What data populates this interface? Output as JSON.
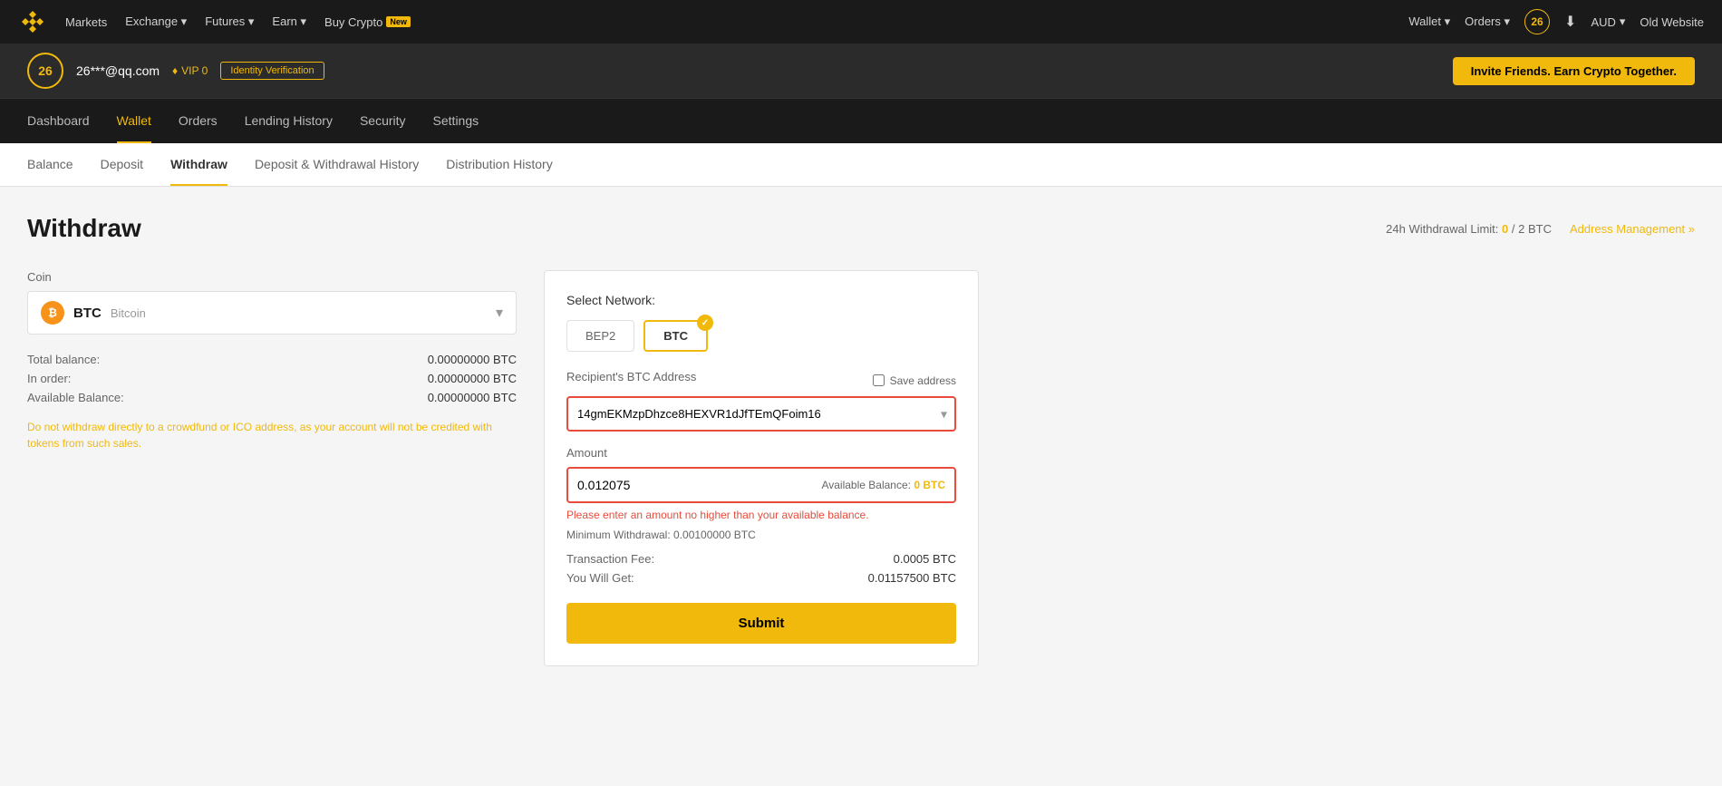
{
  "topNav": {
    "logo_text": "BINANCE",
    "grid_icon": "⊞",
    "nav_items": [
      {
        "label": "Markets",
        "has_dropdown": false
      },
      {
        "label": "Exchange",
        "has_dropdown": true
      },
      {
        "label": "Futures",
        "has_dropdown": true
      },
      {
        "label": "Earn",
        "has_dropdown": true
      },
      {
        "label": "Buy Crypto",
        "has_dropdown": false,
        "badge": "New"
      }
    ],
    "right_items": [
      {
        "label": "Wallet",
        "has_dropdown": true
      },
      {
        "label": "Orders",
        "has_dropdown": true
      }
    ],
    "user_number": "26",
    "currency": "AUD",
    "old_website": "Old Website"
  },
  "userBar": {
    "user_number": "26",
    "email": "26***@qq.com",
    "vip_text": "VIP 0",
    "identity_btn": "Identity Verification",
    "invite_btn": "Invite Friends. Earn Crypto Together."
  },
  "accountNav": {
    "items": [
      {
        "label": "Dashboard",
        "active": false
      },
      {
        "label": "Wallet",
        "active": true
      },
      {
        "label": "Orders",
        "active": false
      },
      {
        "label": "Lending History",
        "active": false
      },
      {
        "label": "Security",
        "active": false
      },
      {
        "label": "Settings",
        "active": false
      }
    ]
  },
  "subNav": {
    "items": [
      {
        "label": "Balance",
        "active": false
      },
      {
        "label": "Deposit",
        "active": false
      },
      {
        "label": "Withdraw",
        "active": true
      },
      {
        "label": "Deposit & Withdrawal History",
        "active": false
      },
      {
        "label": "Distribution History",
        "active": false
      }
    ]
  },
  "page": {
    "title": "Withdraw",
    "withdrawal_limit_label": "24h Withdrawal Limit:",
    "withdrawal_current": "0",
    "withdrawal_separator": "/",
    "withdrawal_max": "2 BTC",
    "address_management": "Address Management »"
  },
  "coinSelector": {
    "symbol": "BTC",
    "full_name": "Bitcoin"
  },
  "balances": {
    "total_label": "Total balance:",
    "total_value": "0.00000000 BTC",
    "order_label": "In order:",
    "order_value": "0.00000000 BTC",
    "available_label": "Available Balance:",
    "available_value": "0.00000000 BTC"
  },
  "warning": {
    "text": "Do not withdraw directly to a crowdfund or ICO address, as your account will not be credited with tokens from such sales."
  },
  "networkSection": {
    "title": "Select Network:",
    "options": [
      {
        "label": "BEP2",
        "active": false
      },
      {
        "label": "BTC",
        "active": true
      }
    ]
  },
  "addressField": {
    "label": "Recipient's BTC Address",
    "value": "14gmEKMzpDhzce8HEXVR1dJfTEmQFoim16",
    "save_address_label": "Save address"
  },
  "amountField": {
    "label": "Amount",
    "value": "0.012075",
    "available_balance_label": "Available Balance:",
    "available_balance_value": "0 BTC",
    "error_text": "Please enter an amount no higher than your available balance.",
    "min_withdrawal_label": "Minimum Withdrawal:",
    "min_withdrawal_value": "0.00100000 BTC"
  },
  "feeSection": {
    "fee_label": "Transaction Fee:",
    "fee_value": "0.0005 BTC",
    "receive_label": "You Will Get:",
    "receive_value": "0.01157500 BTC"
  },
  "submitBtn": {
    "label": "Submit"
  }
}
